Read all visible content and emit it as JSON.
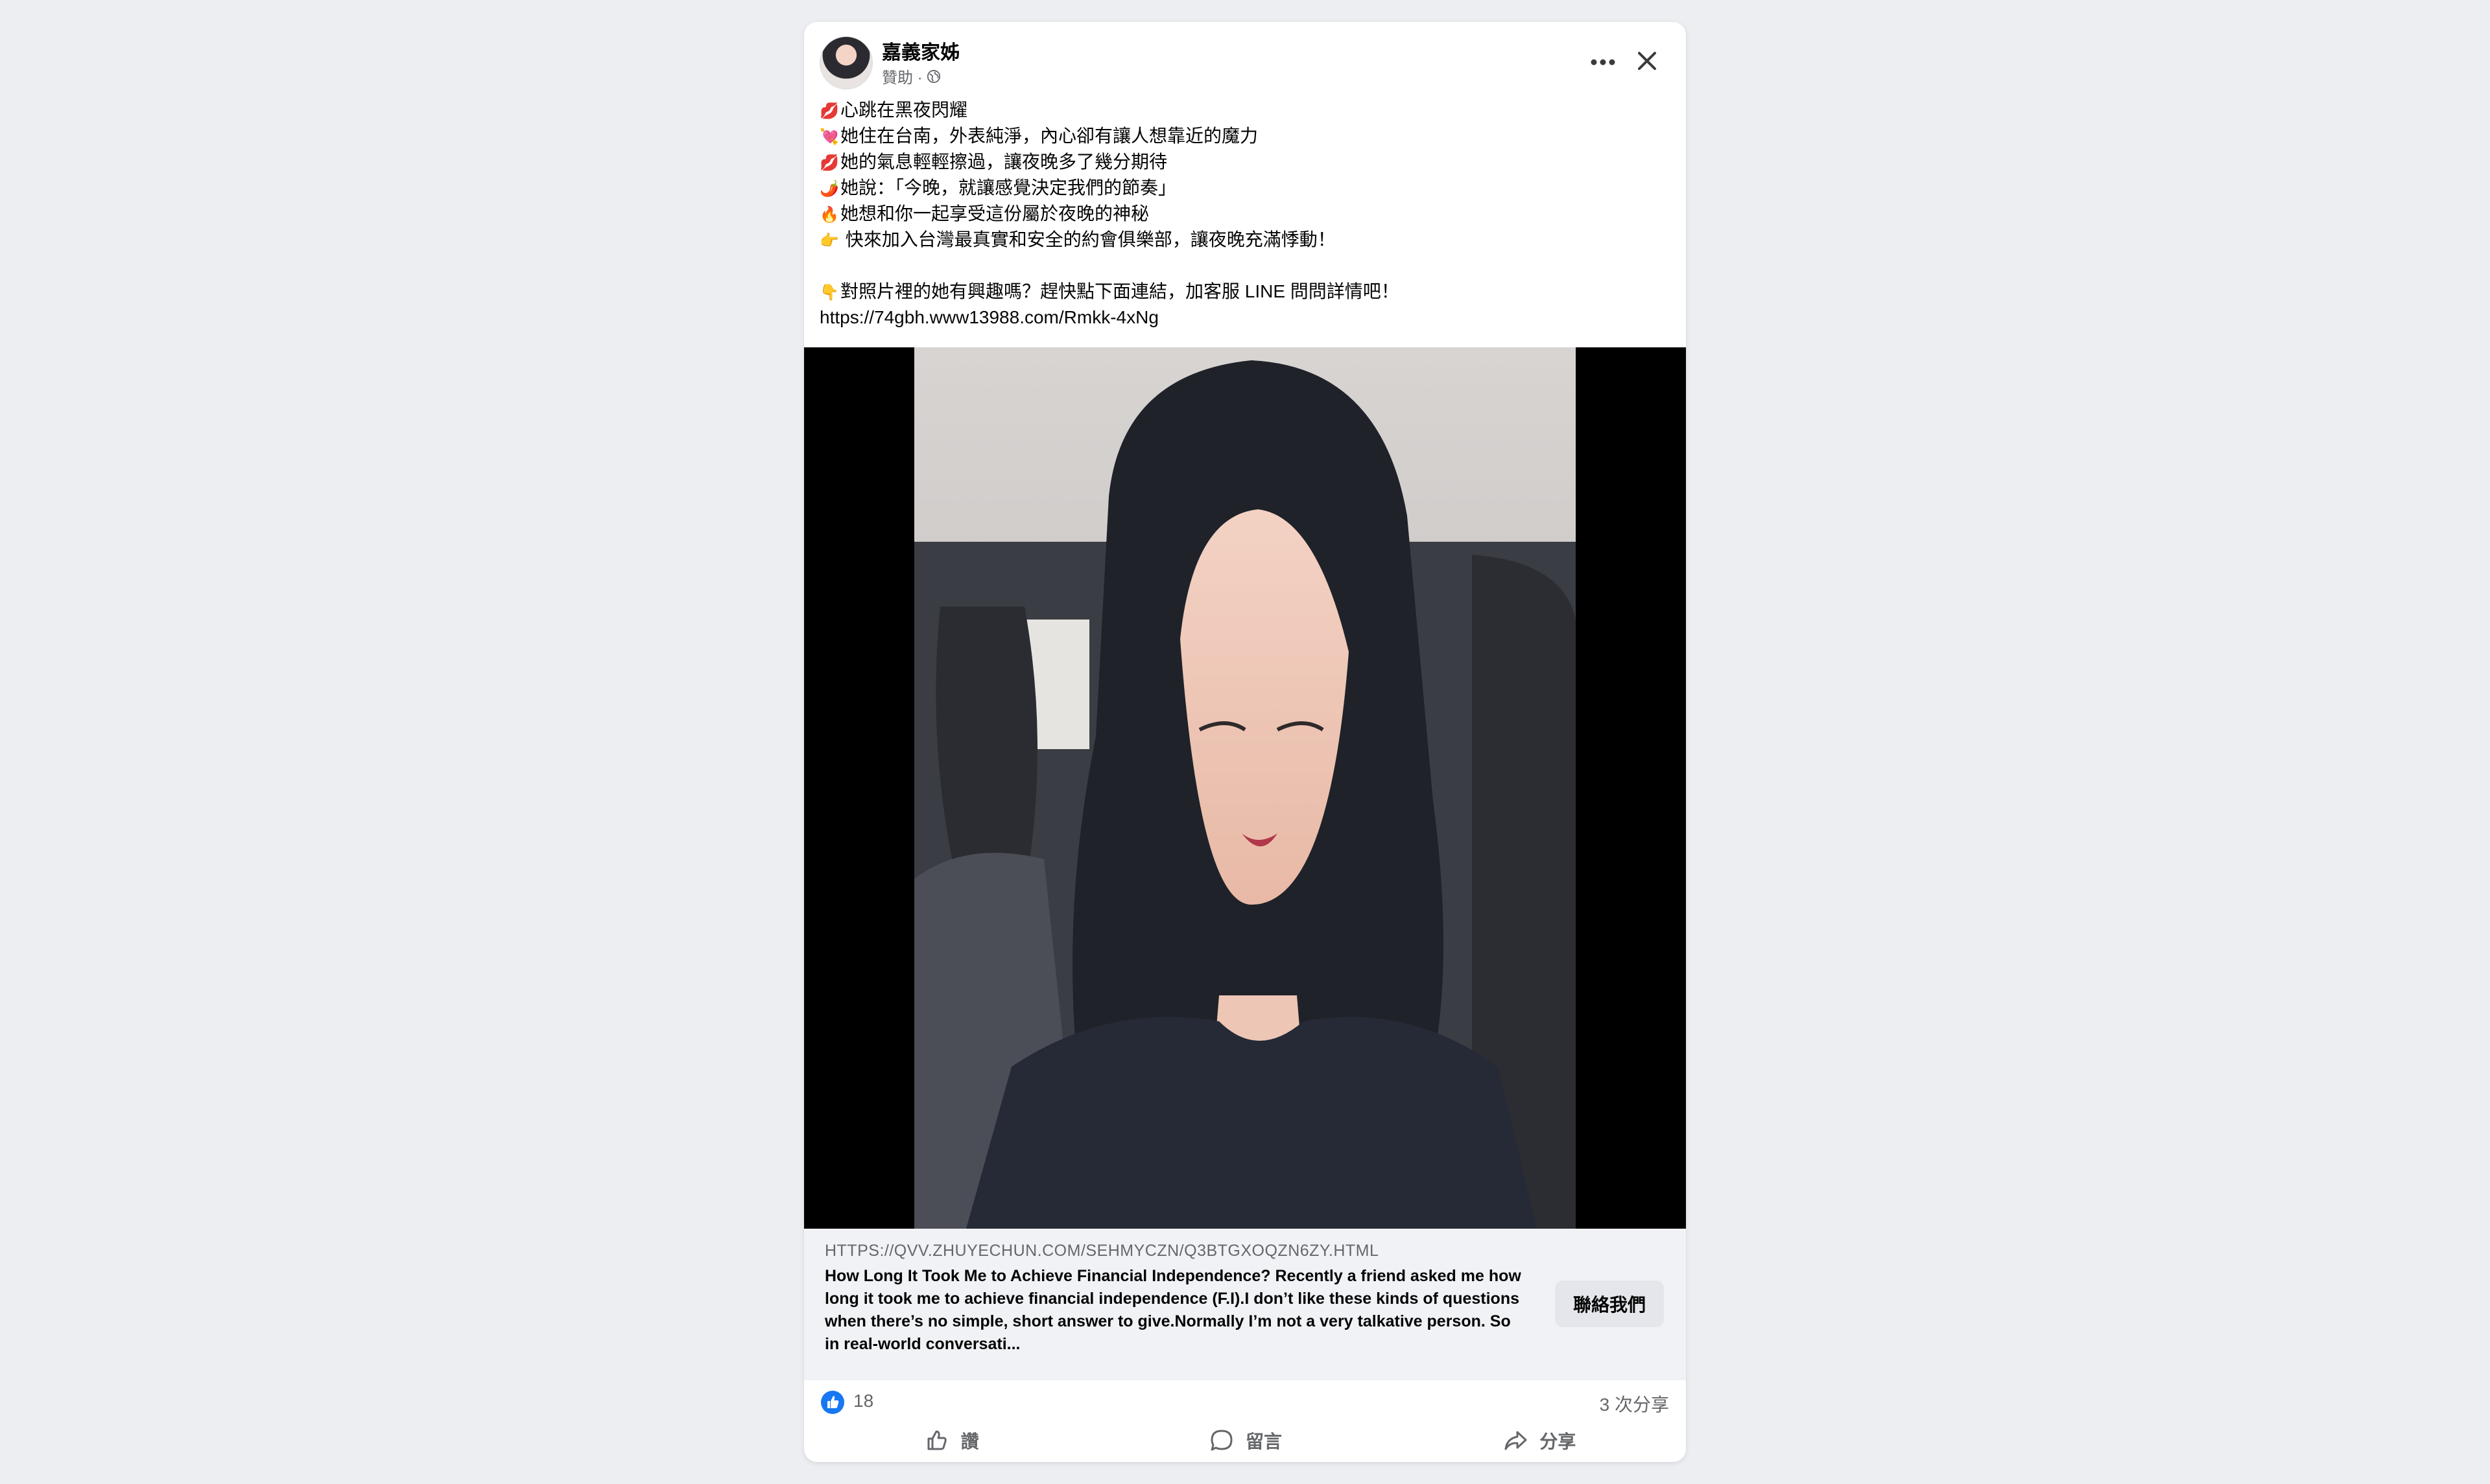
{
  "post": {
    "page_name": "嘉義家姊",
    "sponsored_label": "贊助 ·",
    "audience_icon": "globe-icon",
    "menu_icon": "more-dots-icon",
    "close_icon": "close-icon",
    "caption_lines": [
      {
        "icon": "💋",
        "text": "心跳在黑夜閃耀"
      },
      {
        "icon": "💘",
        "text": "她住在台南，外表純淨，內心卻有讓人想靠近的魔力"
      },
      {
        "icon": "💋",
        "text": "她的氣息輕輕擦過，讓夜晚多了幾分期待"
      },
      {
        "icon": "🌶️",
        "text": "她說：「今晚，就讓感覺決定我們的節奏」"
      },
      {
        "icon": "🔥",
        "text": "她想和你一起享受這份屬於夜晚的神秘"
      },
      {
        "icon": "👉",
        "text": " 快來加入台灣最真實和安全的約會俱樂部，讓夜晚充滿悸動！"
      }
    ],
    "caption_lines_2": [
      {
        "icon": "👇",
        "text": "對照片裡的她有興趣嗎？趕快點下面連結，加客服 LINE 問問詳情吧！"
      }
    ],
    "caption_url": "https://74gbh.www13988.com/Rmkk-4xNg"
  },
  "link_preview": {
    "domain": "HTTPS://QVV.ZHUYECHUN.COM/SEHMYCZN/Q3BTGXOQZN6ZY.HTML",
    "description": "How Long It Took Me to Achieve Financial Independence? Recently a friend asked me how long it took me to achieve financial independence (F.I).I don’t like these kinds of questions when there’s no simple, short answer to give.Normally I’m not a very talkative person. So in real-world conversati...",
    "cta_label": "聯絡我們"
  },
  "stats": {
    "like_count": "18",
    "share_count": "3 次分享"
  },
  "actions": {
    "like_label": "讚",
    "comment_label": "留言",
    "share_label": "分享"
  },
  "colors": {
    "page_background": "#eceef2",
    "card_background": "#ffffff",
    "link_box_background": "#f0f2f5",
    "like_blue": "#1877f2",
    "secondary_text": "#65676b"
  }
}
